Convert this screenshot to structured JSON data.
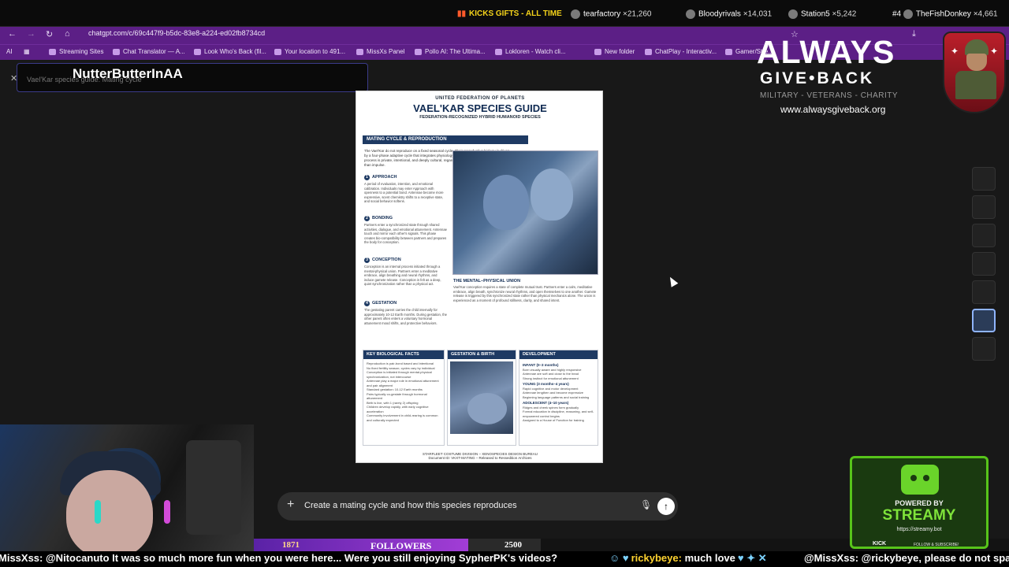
{
  "topbar": {
    "kicks_title": "KICKS GIFTS - ALL TIME",
    "leaders": [
      {
        "rank": "",
        "name": "tearfactory",
        "value": "×21,260"
      },
      {
        "rank": "",
        "name": "Bloodyrivals",
        "value": "×14,031"
      },
      {
        "rank": "",
        "name": "Station5",
        "value": "×5,242"
      },
      {
        "rank": "#4",
        "name": "TheFishDonkey",
        "value": "×4,661"
      }
    ]
  },
  "browser": {
    "url": "chatgpt.com/c/69c447f9-b5dc-83e8-a224-ed02fb8734cd",
    "bookmarks": [
      "Streaming Sites",
      "Chat Translator — A...",
      "Look Who's Back (fil...",
      "Your location to 491...",
      "MissXs Panel",
      "Pollo AI: The Ultima...",
      "Lokloren - Watch cli...",
      "New folder",
      "ChatPlay - Interactiv...",
      "Gamer/Stre..."
    ]
  },
  "overlay_name": {
    "name": "NutterButterInAA",
    "ghost": "Vael'Kar species guide: Mating cycle"
  },
  "document": {
    "org": "UNITED FEDERATION OF PLANETS",
    "title": "VAEL'KAR SPECIES GUIDE",
    "subtitle": "FEDERATION-RECOGNIZED HYBRID HUMANOID SPECIES",
    "section": "MATING CYCLE & REPRODUCTION",
    "intro": "The Vael'Kar do not reproduce on a fixed seasonal cycle. Their reproductive biology is driven by a four-phase adaptive cycle that integrates physiology, emotion, and environment. The process is private, intentional, and deeply cultural, regarded as an act of trust not design rather than impulse.",
    "steps": [
      {
        "num": "1",
        "title": "APPROACH",
        "text": "A period of evaluation, intention, and emotional calibration. Individuals may enter Approach with openness to a potential bond. Antennae become more expressive, scent chemistry shifts to a receptive state, and social behavior softens."
      },
      {
        "num": "2",
        "title": "BONDING",
        "text": "Partners enter a synchronized state through shared activities, dialogue, and emotional attunement. Antennae touch and mirror each other's signals. This phase creates bio-compatibility between partners and prepares the body for conception."
      },
      {
        "num": "3",
        "title": "CONCEPTION",
        "text": "Conception is an internal process initiated through a mental-physical union. Partners enter a meditative embrace, align breathing and neural rhythms, and induce gamete release. Conception is felt as a deep, quiet synchronization rather than a physical act."
      },
      {
        "num": "4",
        "title": "GESTATION",
        "text": "The gestating parent carries the child internally for approximately 10-12 Earth months. During gestation, the other parent often enters a voluntary hormonal attunement mood shifts, and protective behaviors."
      }
    ],
    "union_title": "THE MENTAL–PHYSICAL UNION",
    "union_text": "Vael'Kar conception requires a state of complete mutual trust. Partners enter a calm, meditative embrace, align breath, synchronize neural rhythms, and open themselves to one another. Gamete release is triggered by this synchronized state rather than physical mechanics alone. The union is experienced as a moment of profound stillness, clarity, and shared intent.",
    "panels": {
      "facts_title": "KEY BIOLOGICAL FACTS",
      "facts": [
        "Reproduction is pair-bond based and intentional",
        "No fixed fertility season; cycles vary by individual",
        "Conception is initiated through mental-physical synchronization, not intercourse",
        "Antennae play a major role in emotional attunement and pair alignment",
        "Standard gestation: 10-12 Earth months",
        "Pairs typically co-gestate through hormonal attunement",
        "Birth is live, with 1 (rarely 2) offspring",
        "Children develop rapidly, with early cognitive acceleration",
        "Community involvement in child-rearing is common and culturally expected"
      ],
      "birth_title": "GESTATION & BIRTH",
      "dev_title": "DEVELOPMENT",
      "dev_groups": [
        {
          "title": "INFANT (0–3 months)",
          "items": [
            "Born visually aware and highly responsive",
            "Antennae are soft and close to the head",
            "Strong instinct for emotional attunement"
          ]
        },
        {
          "title": "YOUNG (3 months–4 years)",
          "items": [
            "Rapid cognitive and motor development",
            "Antennae lengthen and become expressive",
            "Beginning language patterns and social training"
          ]
        },
        {
          "title": "ADOLESCENT (4–10 years)",
          "items": [
            "Ridges and cheek spines form gradually",
            "Formal education in discipline, reasoning, and self-empowered control begins",
            "Assigned to a House of Function for training"
          ]
        }
      ]
    },
    "footer1": "STARFLEET COSTUME DIVISION – XENOSPECIES DESIGN BUREAU",
    "footer2": "Document ID: VKXT-MATING – Released to Ressedition Archives"
  },
  "chat_input": {
    "text": "Create a mating cycle and how this species reproduces"
  },
  "sponsor": {
    "line1": "ALWAYS",
    "line2": "GIVE•BACK",
    "line3": "MILITARY - VETERANS - CHARITY",
    "url": "www.alwaysgiveback.org"
  },
  "streamy": {
    "powered": "POWERED BY",
    "name": "STREAMY",
    "url": "https://streamy.bot",
    "kick": "KICK",
    "follow": "FOLLOW & SUBSCRIBE!"
  },
  "followers": {
    "current": "1871",
    "label": "FOLLOWERS",
    "goal": "2500",
    "progress": 0.748
  },
  "ticker": {
    "msg1_user": "MissXss:",
    "msg1_text": "@Nitocanuto It was so much more fun when you were here... Were you still enjoying SypherPK's videos?",
    "msg2_user": "rickybeye:",
    "msg2_text": "much love",
    "msg3_user": "@MissXss:",
    "msg3_text": "@rickybeye, please do not spam."
  }
}
